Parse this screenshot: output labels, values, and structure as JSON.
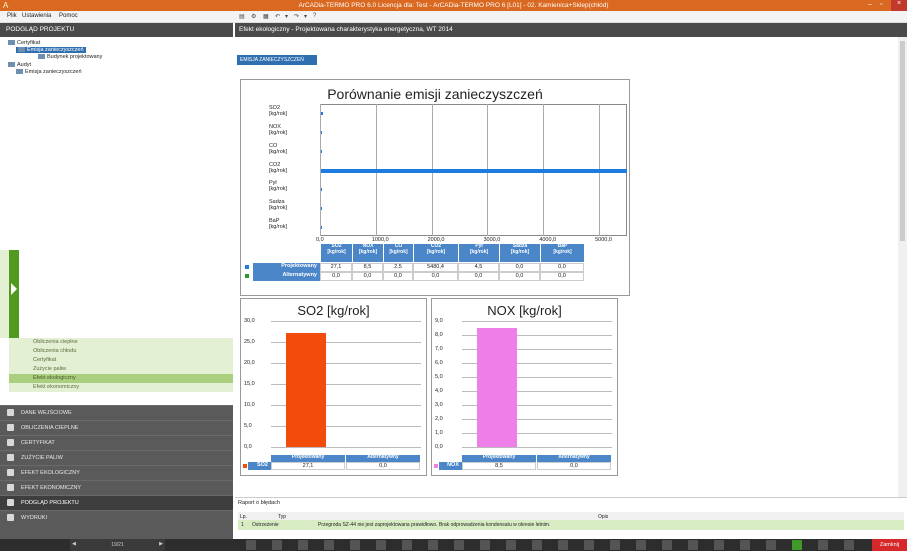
{
  "window": {
    "title": "ArCADia-TERMO PRO 6.0 Licencja dla: Test - ArCADia-TERMO PRO 6 [L01] - 02. Kamienica+Sklep(chłód)"
  },
  "menu": {
    "file": "Plik",
    "settings": "Ustawienia",
    "help": "Pomoc"
  },
  "left": {
    "header": "PODGLĄD PROJEKTU",
    "tree": {
      "certyfikat": "Certyfikat",
      "emisja1": "Emisja zanieczyszczeń",
      "budynek": "Budynek projektowany",
      "audyt": "Audyt",
      "emisja2": "Emisja zanieczyszczeń"
    },
    "subnav": [
      "Obliczenia ciepłne",
      "Obliczenia chłodu",
      "Certyfikat",
      "Zużycie paliw",
      "Efekt ekologiczny",
      "Efekt ekonomiczny"
    ],
    "mainnav": [
      "DANE WEJŚCIOWE",
      "OBLICZENIA CIEPLNE",
      "CERTYFIKAT",
      "ZUŻYCIE PALIW",
      "EFEKT EKOLOGICZNY",
      "EFEKT EKONOMICZNY",
      "PODGLĄD PROJEKTU",
      "WYDRUKI"
    ]
  },
  "right": {
    "breadcrumb": "Efekt ekologiczny - Projektowana charakterystyka energetyczna, WT 2014",
    "tab": "EMISJA ZANIECZYSZCZEŃ"
  },
  "chart_data": [
    {
      "type": "bar",
      "orientation": "horizontal",
      "title": "Porównanie emisji zanieczyszczeń",
      "categories": [
        "SO2 [kg/rok]",
        "NOX [kg/rok]",
        "CO [kg/rok]",
        "CO2 [kg/rok]",
        "Pył [kg/rok]",
        "Sadza [kg/rok]",
        "BaP [kg/rok]"
      ],
      "x_ticks": [
        "0,0",
        "1000,0",
        "2000,0",
        "3000,0",
        "4000,0",
        "5000,0"
      ],
      "xlim": [
        0,
        5500
      ],
      "series": [
        {
          "name": "Projektowany",
          "values": [
            27.1,
            8.5,
            2.5,
            5480.4,
            4.5,
            0.0,
            0.0
          ],
          "labels": [
            "27,1",
            "8,5",
            "2,5",
            "5480,4",
            "4,5",
            "0,0",
            "0,0"
          ],
          "color": "#1e7be0"
        },
        {
          "name": "Alternatywny",
          "values": [
            0,
            0,
            0,
            0,
            0,
            0,
            0
          ],
          "labels": [
            "0,0",
            "0,0",
            "0,0",
            "0,0",
            "0,0",
            "0,0",
            "0,0"
          ],
          "color": "#2a9a2a"
        }
      ]
    },
    {
      "type": "bar",
      "title": "SO2 [kg/rok]",
      "categories": [
        "Projektowany",
        "Alternatywny"
      ],
      "values": [
        27.1,
        0.0
      ],
      "labels": [
        "27,1",
        "0,0"
      ],
      "row_label": "SO2",
      "y_ticks": [
        "0,0",
        "5,0",
        "10,0",
        "15,0",
        "20,0",
        "25,0",
        "30,0"
      ],
      "ylim": [
        0,
        30
      ],
      "color": "#f24b0c"
    },
    {
      "type": "bar",
      "title": "NOX [kg/rok]",
      "categories": [
        "Projektowany",
        "Alternatywny"
      ],
      "values": [
        8.5,
        0.0
      ],
      "labels": [
        "8,5",
        "0,0"
      ],
      "row_label": "NOX",
      "y_ticks": [
        "0,0",
        "1,0",
        "2,0",
        "3,0",
        "4,0",
        "5,0",
        "6,0",
        "7,0",
        "8,0",
        "9,0"
      ],
      "ylim": [
        0,
        9
      ],
      "color": "#ef7fe8"
    }
  ],
  "report": {
    "label": "Raport o błędach",
    "headers": [
      "Lp.",
      "Typ",
      "Opis"
    ],
    "row": [
      "1",
      "Ostrzeżenie",
      "Przegroda SZ-44 nie jest zaprojektowana prawidłowo. Brak odprowadzenia kondensatu w okresie letnim."
    ]
  },
  "bottom": {
    "page": "19/21",
    "close": "Zamknij"
  }
}
